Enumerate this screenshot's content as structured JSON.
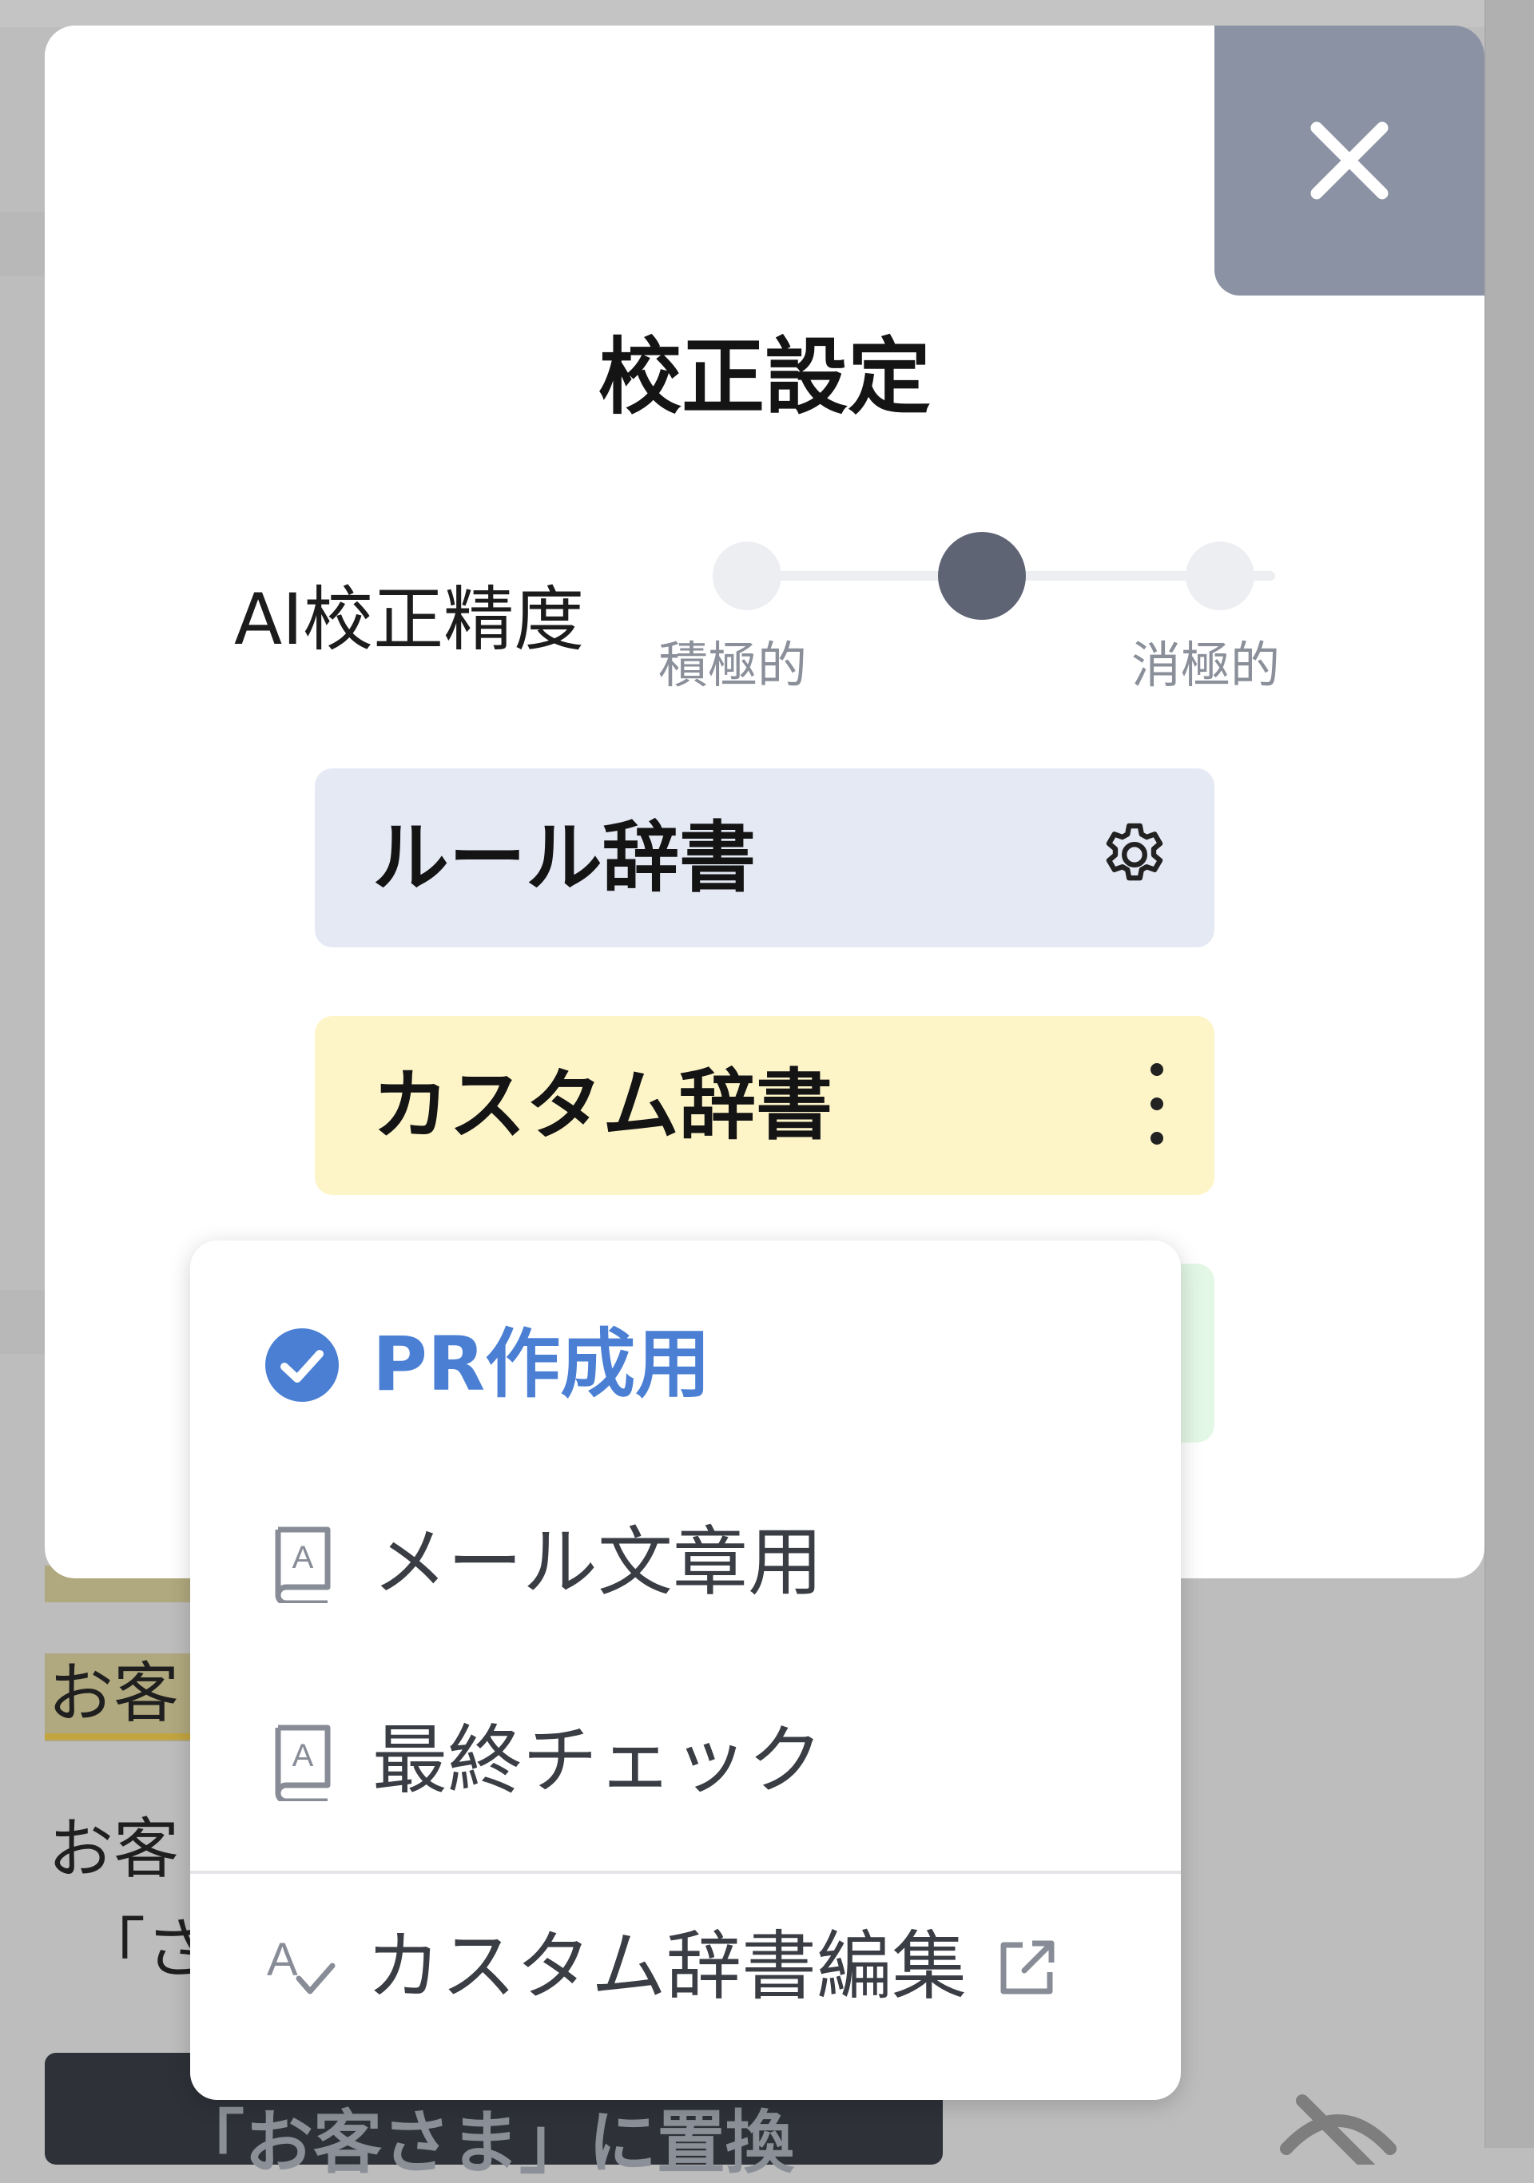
{
  "modal": {
    "title": "校正設定",
    "close_icon": "close-icon",
    "ai_accuracy": {
      "label": "AI校正精度",
      "levels": 3,
      "selected_level": 2,
      "left_caption": "積極的",
      "right_caption": "消極的"
    },
    "dictionaries": [
      {
        "label": "ルール辞書",
        "icon": "gear-icon",
        "color": "#e4e9f4"
      },
      {
        "label": "カスタム辞書",
        "icon": "more-vertical-icon",
        "color": "#fdf5c8"
      },
      {
        "label": "",
        "icon": "",
        "color": "#e3f7e6"
      }
    ]
  },
  "dropdown": {
    "items": [
      {
        "label": "PR作成用",
        "icon": "check-circle-icon",
        "selected": true
      },
      {
        "label": "メール文章用",
        "icon": "dictionary-book-icon",
        "selected": false
      },
      {
        "label": "最終チェック",
        "icon": "dictionary-book-icon",
        "selected": false
      }
    ],
    "edit_link": {
      "label": "カスタム辞書編集",
      "icon": "spellcheck-icon",
      "trailing_icon": "external-link-icon"
    }
  },
  "background": {
    "text_line_1": "お客",
    "text_line_2": "お客",
    "text_line_3": "「さ",
    "replace_button_label": "「お客さま」に置換",
    "visibility_icon": "eye-off-icon"
  },
  "colors": {
    "accent_blue": "#4a7fd4",
    "close_button_bg": "#8a92a3",
    "slider_knob": "#5f6475"
  }
}
